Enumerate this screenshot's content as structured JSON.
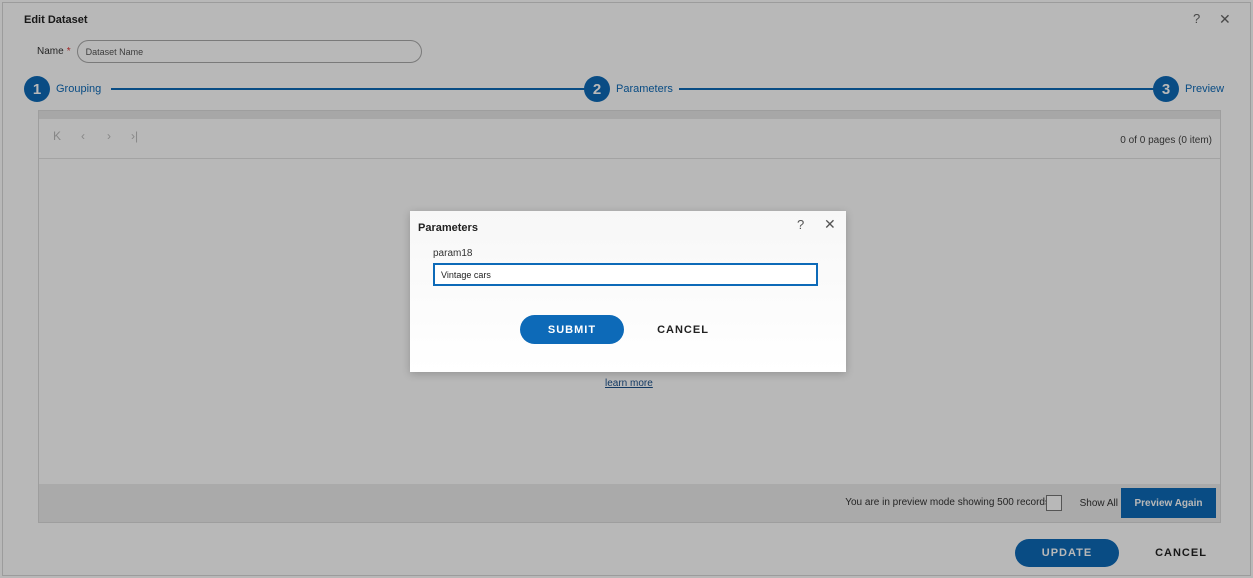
{
  "window": {
    "title": "Edit Dataset",
    "help_icon": "?",
    "close_icon": "✕"
  },
  "name_field": {
    "label": "Name",
    "required_marker": "*",
    "placeholder": "Dataset Name",
    "value": ""
  },
  "steps": [
    {
      "number": "1",
      "label": "Grouping"
    },
    {
      "number": "2",
      "label": "Parameters"
    },
    {
      "number": "3",
      "label": "Preview"
    }
  ],
  "pager": {
    "first_icon": "K",
    "prev_icon": "‹",
    "next_icon": "›",
    "last_icon": "›|",
    "info": "0 of 0 pages (0 item)"
  },
  "grid": {
    "learn_more": "learn more"
  },
  "footer": {
    "preview_note": "You are in preview mode showing 500 records",
    "show_all_label": "Show All",
    "preview_again": "Preview Again"
  },
  "actions": {
    "update": "UPDATE",
    "cancel": "CANCEL"
  },
  "dialog": {
    "title": "Parameters",
    "help_icon": "?",
    "close_icon": "✕",
    "param_label": "param18",
    "param_value": "Vintage cars",
    "submit": "SUBMIT",
    "cancel": "CANCEL"
  },
  "colors": {
    "accent": "#0d6ab8",
    "overlay": "rgba(0,0,0,0.28)"
  }
}
